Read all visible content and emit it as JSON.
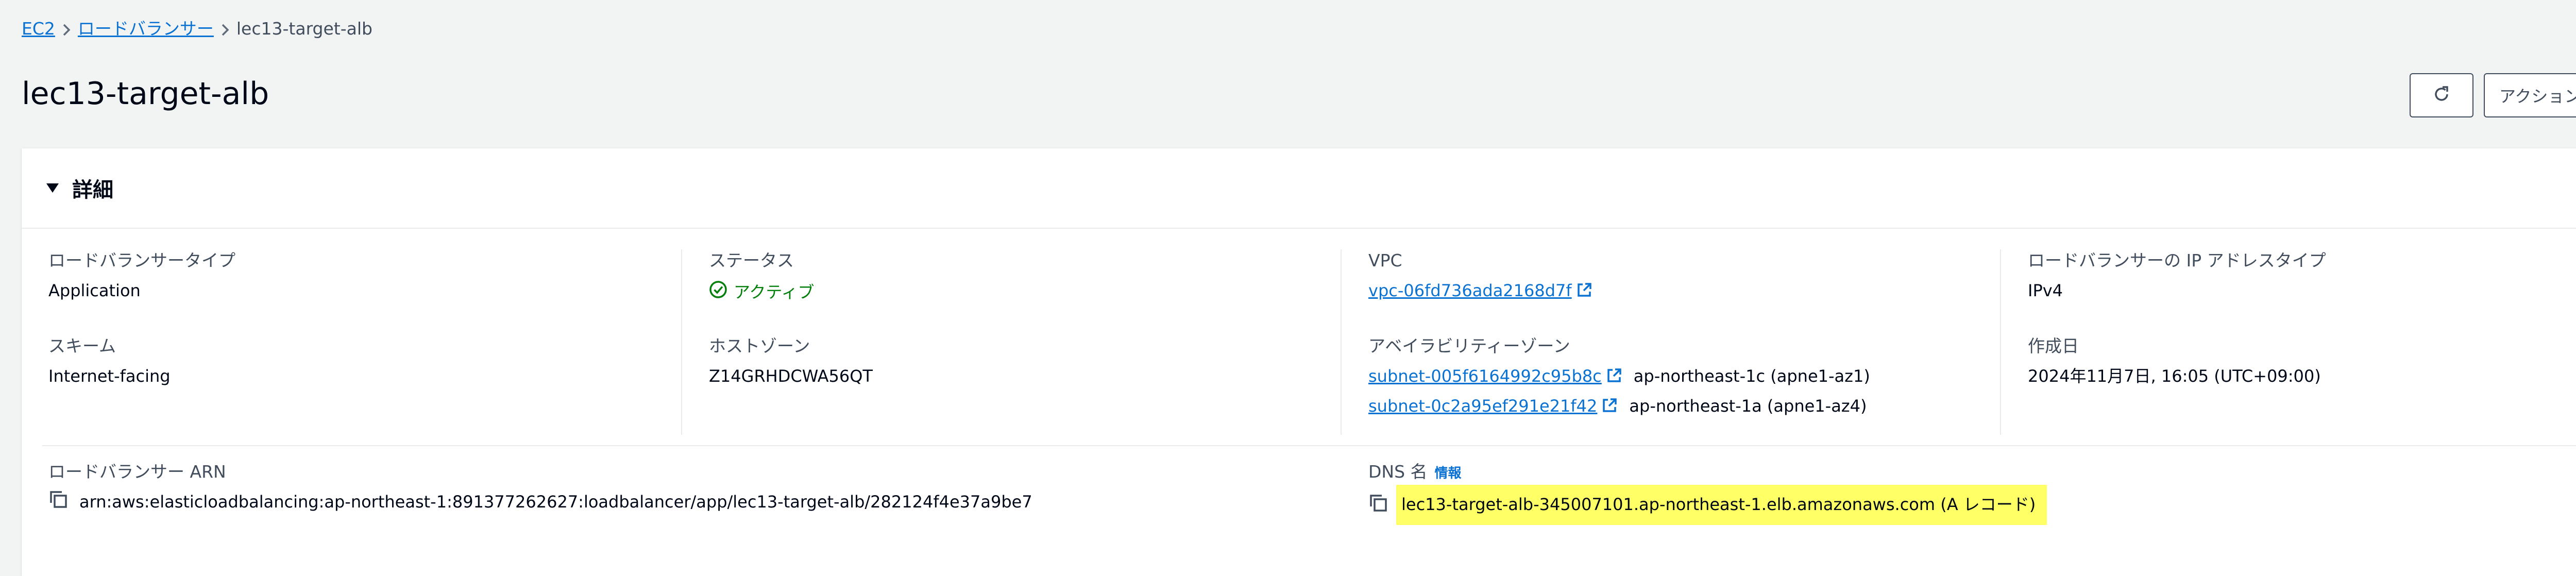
{
  "breadcrumb": {
    "items": [
      "EC2",
      "ロードバランサー"
    ],
    "current": "lec13-target-alb"
  },
  "page": {
    "title": "lec13-target-alb",
    "actions_label": "アクション"
  },
  "details": {
    "section_title": "詳細",
    "lb_type": {
      "label": "ロードバランサータイプ",
      "value": "Application"
    },
    "scheme": {
      "label": "スキーム",
      "value": "Internet-facing"
    },
    "status": {
      "label": "ステータス",
      "value": "アクティブ"
    },
    "hosted_zone": {
      "label": "ホストゾーン",
      "value": "Z14GRHDCWA56QT"
    },
    "vpc": {
      "label": "VPC",
      "value": "vpc-06fd736ada2168d7f"
    },
    "azs": {
      "label": "アベイラビリティーゾーン",
      "items": [
        {
          "subnet": "subnet-005f6164992c95b8c",
          "zone": "ap-northeast-1c (apne1-az1)"
        },
        {
          "subnet": "subnet-0c2a95ef291e21f42",
          "zone": "ap-northeast-1a (apne1-az4)"
        }
      ]
    },
    "ip_type": {
      "label": "ロードバランサーの IP アドレスタイプ",
      "value": "IPv4"
    },
    "created": {
      "label": "作成日",
      "value": "2024年11月7日, 16:05 (UTC+09:00)"
    },
    "arn": {
      "label": "ロードバランサー ARN",
      "value": "arn:aws:elasticloadbalancing:ap-northeast-1:891377262627:loadbalancer/app/lec13-target-alb/282124f4e37a9be7"
    },
    "dns": {
      "label": "DNS 名",
      "info_label": "情報",
      "value": "lec13-target-alb-345007101.ap-northeast-1.elb.amazonaws.com (A レコード)"
    }
  },
  "colors": {
    "link": "#0972d3",
    "success": "#037f0c",
    "highlight": "#ffff66",
    "background": "#f2f3f3"
  }
}
